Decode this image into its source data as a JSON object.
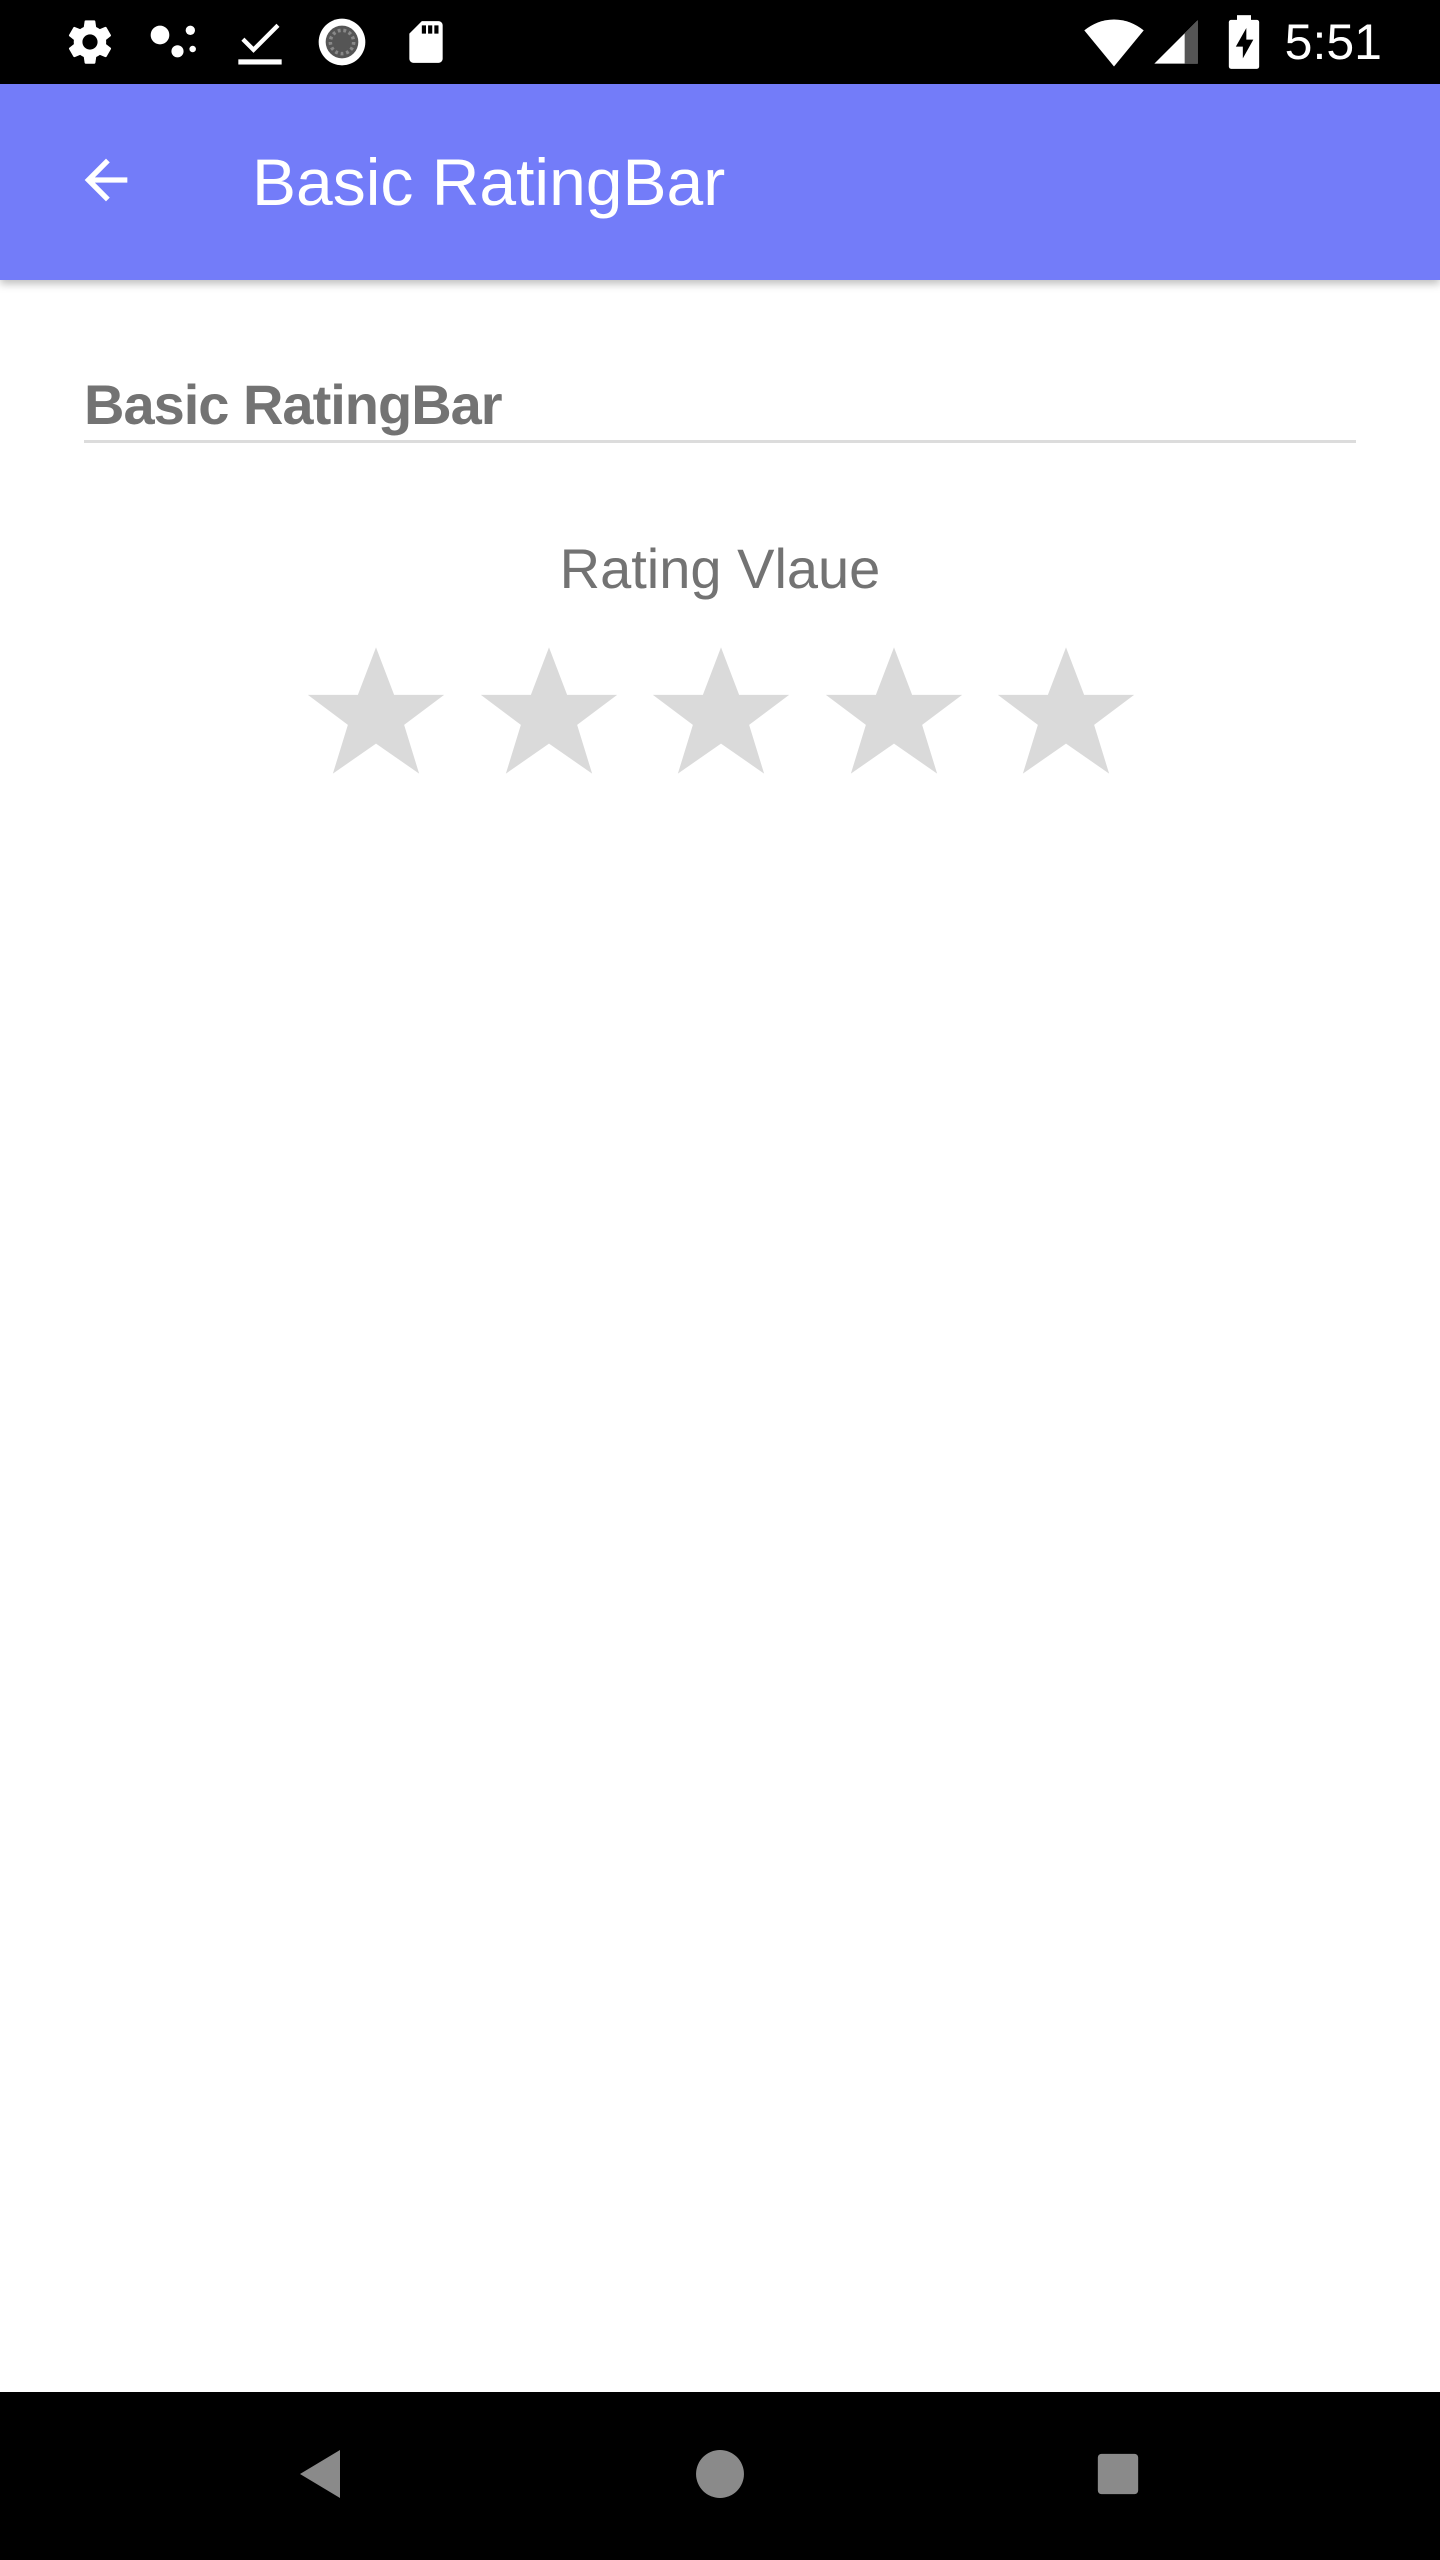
{
  "status_bar": {
    "time": "5:51",
    "left_icons": [
      "gear-icon",
      "assistant-dots-icon",
      "download-done-icon",
      "sync-icon",
      "sd-card-icon"
    ],
    "right_icons": [
      "wifi-icon",
      "signal-icon",
      "battery-charging-icon"
    ]
  },
  "app_bar": {
    "title": "Basic RatingBar",
    "color": "#737CF9"
  },
  "content": {
    "section_title": "Basic RatingBar",
    "rating_label": "Rating Vlaue",
    "rating": {
      "value": 0,
      "max": 5,
      "empty_color": "#DADADA"
    }
  },
  "nav_bar": {
    "icons": [
      "back-triangle-icon",
      "home-circle-icon",
      "recents-square-icon"
    ]
  }
}
